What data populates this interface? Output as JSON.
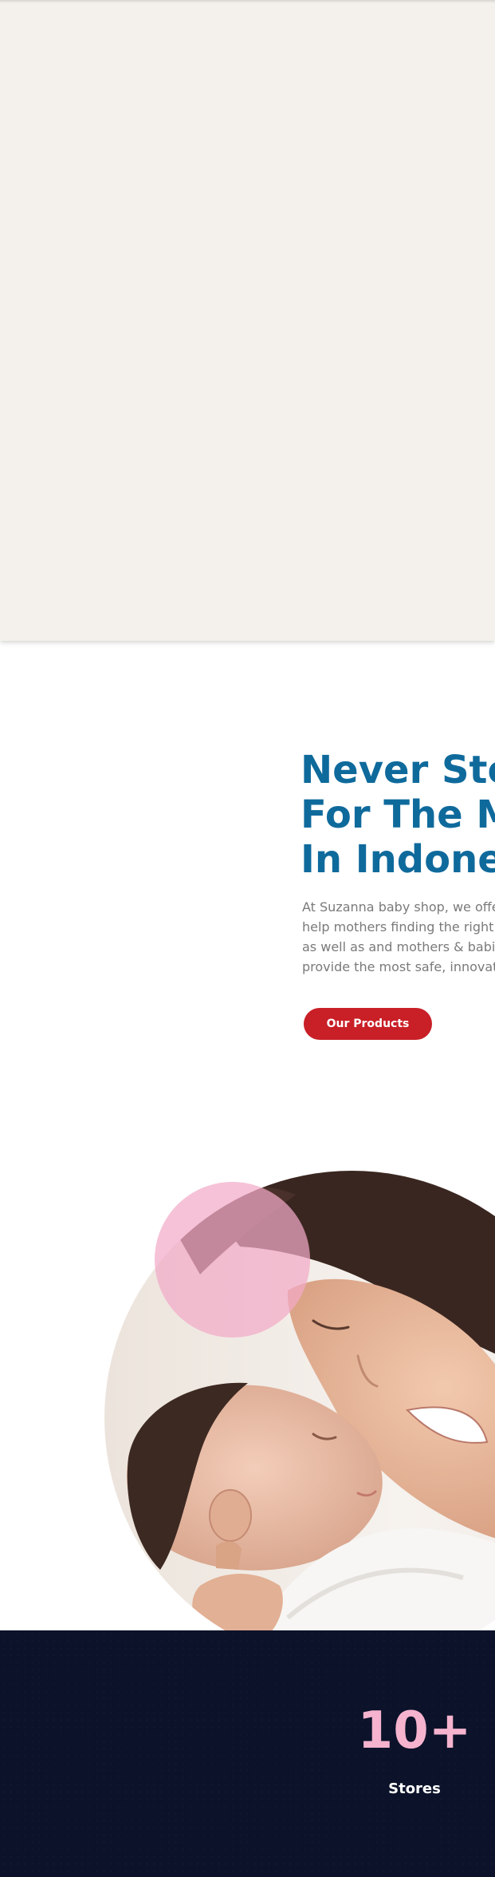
{
  "about": {
    "heading_lines": [
      "Never Stop",
      "For The Mo",
      "In Indonesi"
    ],
    "intro_lines": [
      "At Suzanna baby shop, we offer",
      "help mothers finding the right a",
      "as well as and mothers & babies",
      "provide the most safe, innovativ"
    ],
    "cta_label": "Our Products"
  },
  "stats": [
    {
      "value": "10+",
      "label": "Stores"
    }
  ],
  "colors": {
    "hero_background": "#f4f1ec",
    "heading": "#0f6a9c",
    "cta": "#c91f27",
    "stats_background": "#0b1229",
    "stat_value": "#f5b3ce",
    "pink_circle": "#f2aac8"
  }
}
